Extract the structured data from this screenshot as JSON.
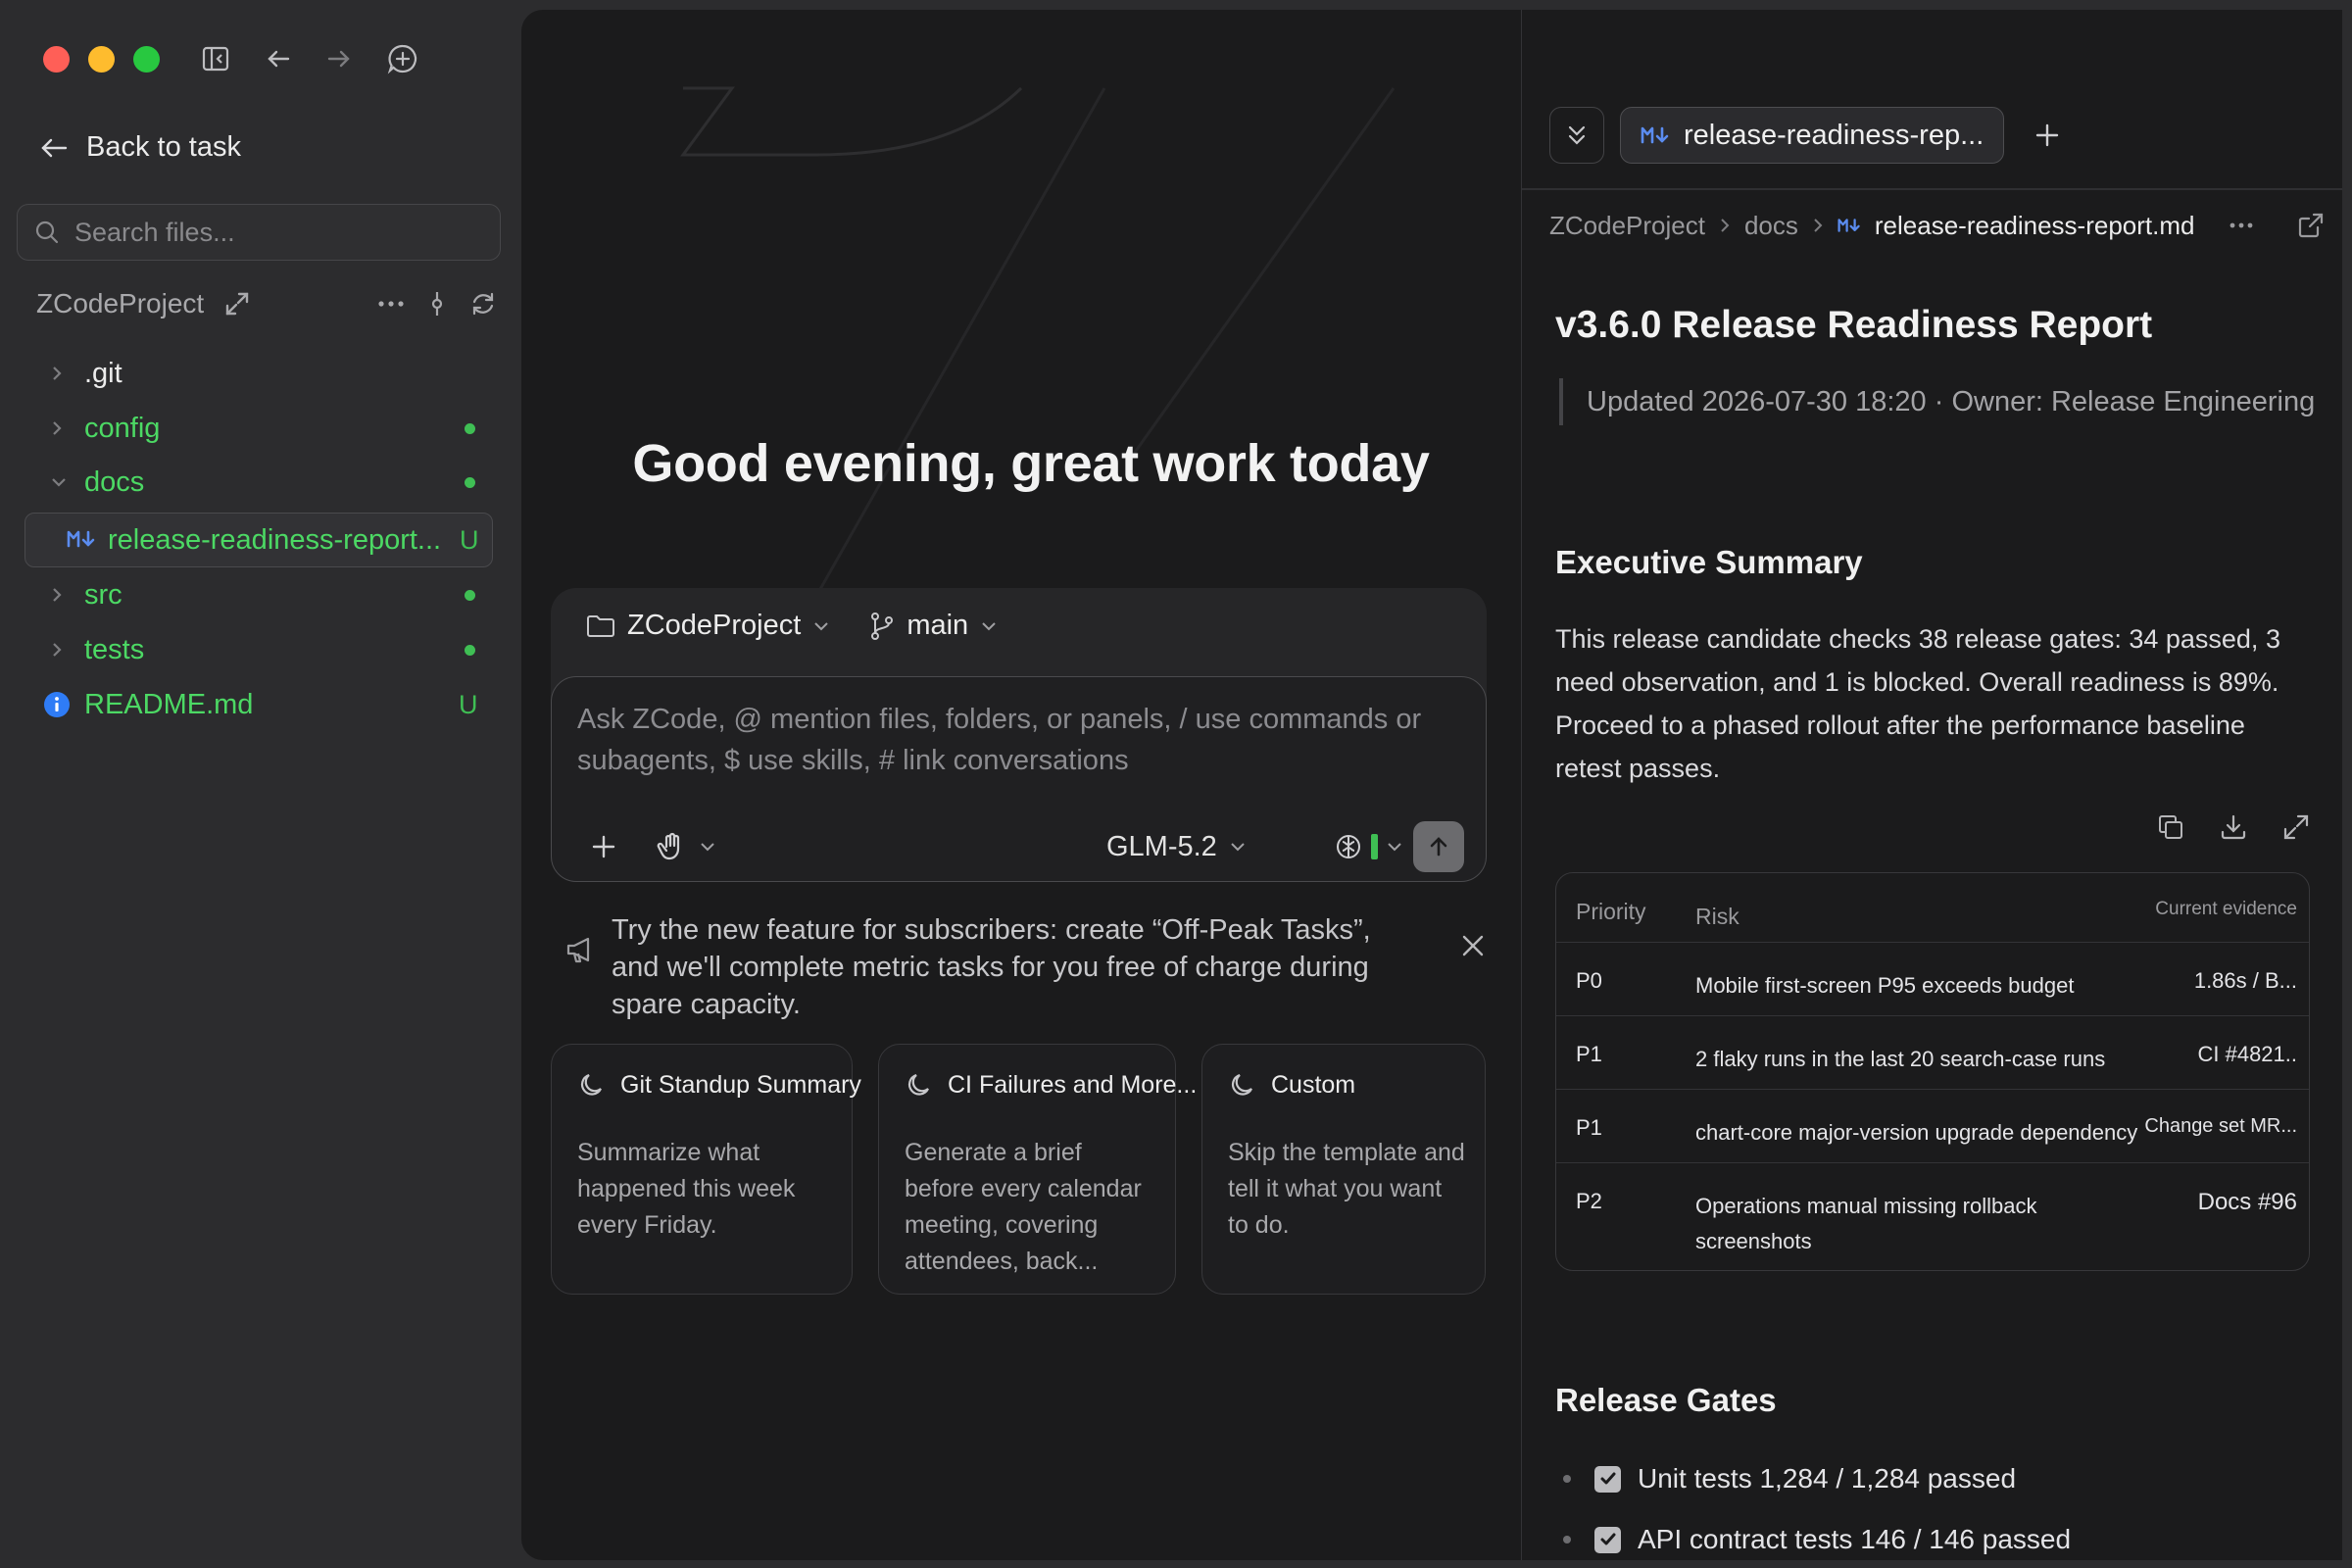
{
  "window": {
    "controls": [
      "close",
      "minimize",
      "maximize"
    ]
  },
  "toolbar": {
    "icons": [
      "sidebar-toggle-icon",
      "back-arrow-icon",
      "forward-arrow-icon",
      "new-chat-icon",
      "help-icon",
      "terminal-icon"
    ]
  },
  "sidebar": {
    "back_label": "Back to task",
    "search_placeholder": "Search files...",
    "project_name": "ZCodeProject",
    "tree": [
      {
        "label": ".git",
        "expanded": false,
        "status": ""
      },
      {
        "label": "config",
        "expanded": false,
        "status": "dot"
      },
      {
        "label": "docs",
        "expanded": true,
        "status": "dot"
      },
      {
        "label": "release-readiness-report...",
        "selected": true,
        "status": "U"
      },
      {
        "label": "src",
        "expanded": false,
        "status": "dot"
      },
      {
        "label": "tests",
        "expanded": false,
        "status": "dot"
      },
      {
        "label": "README.md",
        "status": "U"
      }
    ]
  },
  "center": {
    "greeting": "Good evening, great work today",
    "project_selector": "ZCodeProject",
    "branch_selector": "main",
    "input_placeholder": "Ask ZCode, @ mention files, folders, or panels, / use commands or subagents, $ use skills, # link conversations",
    "model": "GLM-5.2",
    "promo_text": "Try the new feature for subscribers: create “Off-Peak Tasks”, and we'll complete metric tasks for you free of charge during spare capacity.",
    "cards": [
      {
        "title": "Git Standup Summary",
        "desc": "Summarize what happened this week every Friday."
      },
      {
        "title": "CI Failures and More...",
        "desc": "Generate a brief before every calendar meeting, covering attendees, back..."
      },
      {
        "title": "Custom",
        "desc": "Skip the template and tell it what you want to do."
      }
    ]
  },
  "preview": {
    "tab_label": "release-readiness-rep...",
    "breadcrumb": [
      "ZCodeProject",
      "docs",
      "release-readiness-report.md"
    ],
    "title": "v3.6.0 Release Readiness Report",
    "meta": "Updated 2026-07-30 18:20 · Owner: Release Engineering",
    "exec_heading": "Executive Summary",
    "exec_text": "This release candidate checks 38 release gates: 34 passed, 3 need observation, and 1 is blocked. Overall readiness is 89%. Proceed to a phased rollout after the performance baseline retest passes.",
    "table": {
      "headers": [
        "Priority",
        "Risk",
        "Current evidence"
      ],
      "rows": [
        [
          "P0",
          "Mobile first-screen P95 exceeds budget",
          "1.86s / B..."
        ],
        [
          "P1",
          "2 flaky runs in the last 20 search-case runs",
          "CI #4821.."
        ],
        [
          "P1",
          "chart-core major-version upgrade dependency",
          "Change set MR..."
        ],
        [
          "P2",
          "Operations manual missing rollback screenshots",
          "Docs #96"
        ]
      ]
    },
    "gates_heading": "Release Gates",
    "gates": [
      {
        "label": "Unit tests 1,284 / 1,284 passed",
        "checked": true
      },
      {
        "label": "API contract tests 146 / 146 passed",
        "checked": true
      }
    ]
  },
  "colors": {
    "accent_green": "#4cd964",
    "status_dot": "#3fbf54",
    "markdown_blue": "#5b8cf0",
    "info_blue": "#2f7cf6"
  }
}
